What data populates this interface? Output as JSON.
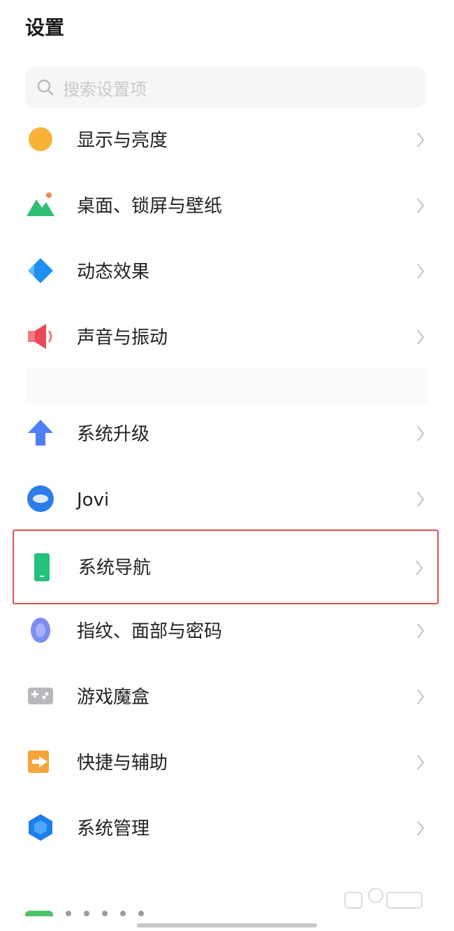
{
  "header": {
    "title": "设置"
  },
  "search": {
    "placeholder": "搜索设置项"
  },
  "settings": {
    "items": [
      {
        "label": "显示与亮度",
        "icon": "display-brightness-icon"
      },
      {
        "label": "桌面、锁屏与壁纸",
        "icon": "wallpaper-icon"
      },
      {
        "label": "动态效果",
        "icon": "motion-effects-icon"
      },
      {
        "label": "声音与振动",
        "icon": "sound-vibration-icon"
      },
      {
        "label": "系统升级",
        "icon": "system-upgrade-icon"
      },
      {
        "label": "Jovi",
        "icon": "jovi-icon"
      },
      {
        "label": "系统导航",
        "icon": "system-navigation-icon",
        "highlighted": true
      },
      {
        "label": "指纹、面部与密码",
        "icon": "fingerprint-icon"
      },
      {
        "label": "游戏魔盒",
        "icon": "game-box-icon"
      },
      {
        "label": "快捷与辅助",
        "icon": "shortcuts-accessibility-icon"
      },
      {
        "label": "系统管理",
        "icon": "system-management-icon"
      }
    ]
  },
  "colors": {
    "highlight_border": "#d9534f",
    "chevron": "#c4c4c6",
    "search_bg": "#f6f6f7"
  }
}
